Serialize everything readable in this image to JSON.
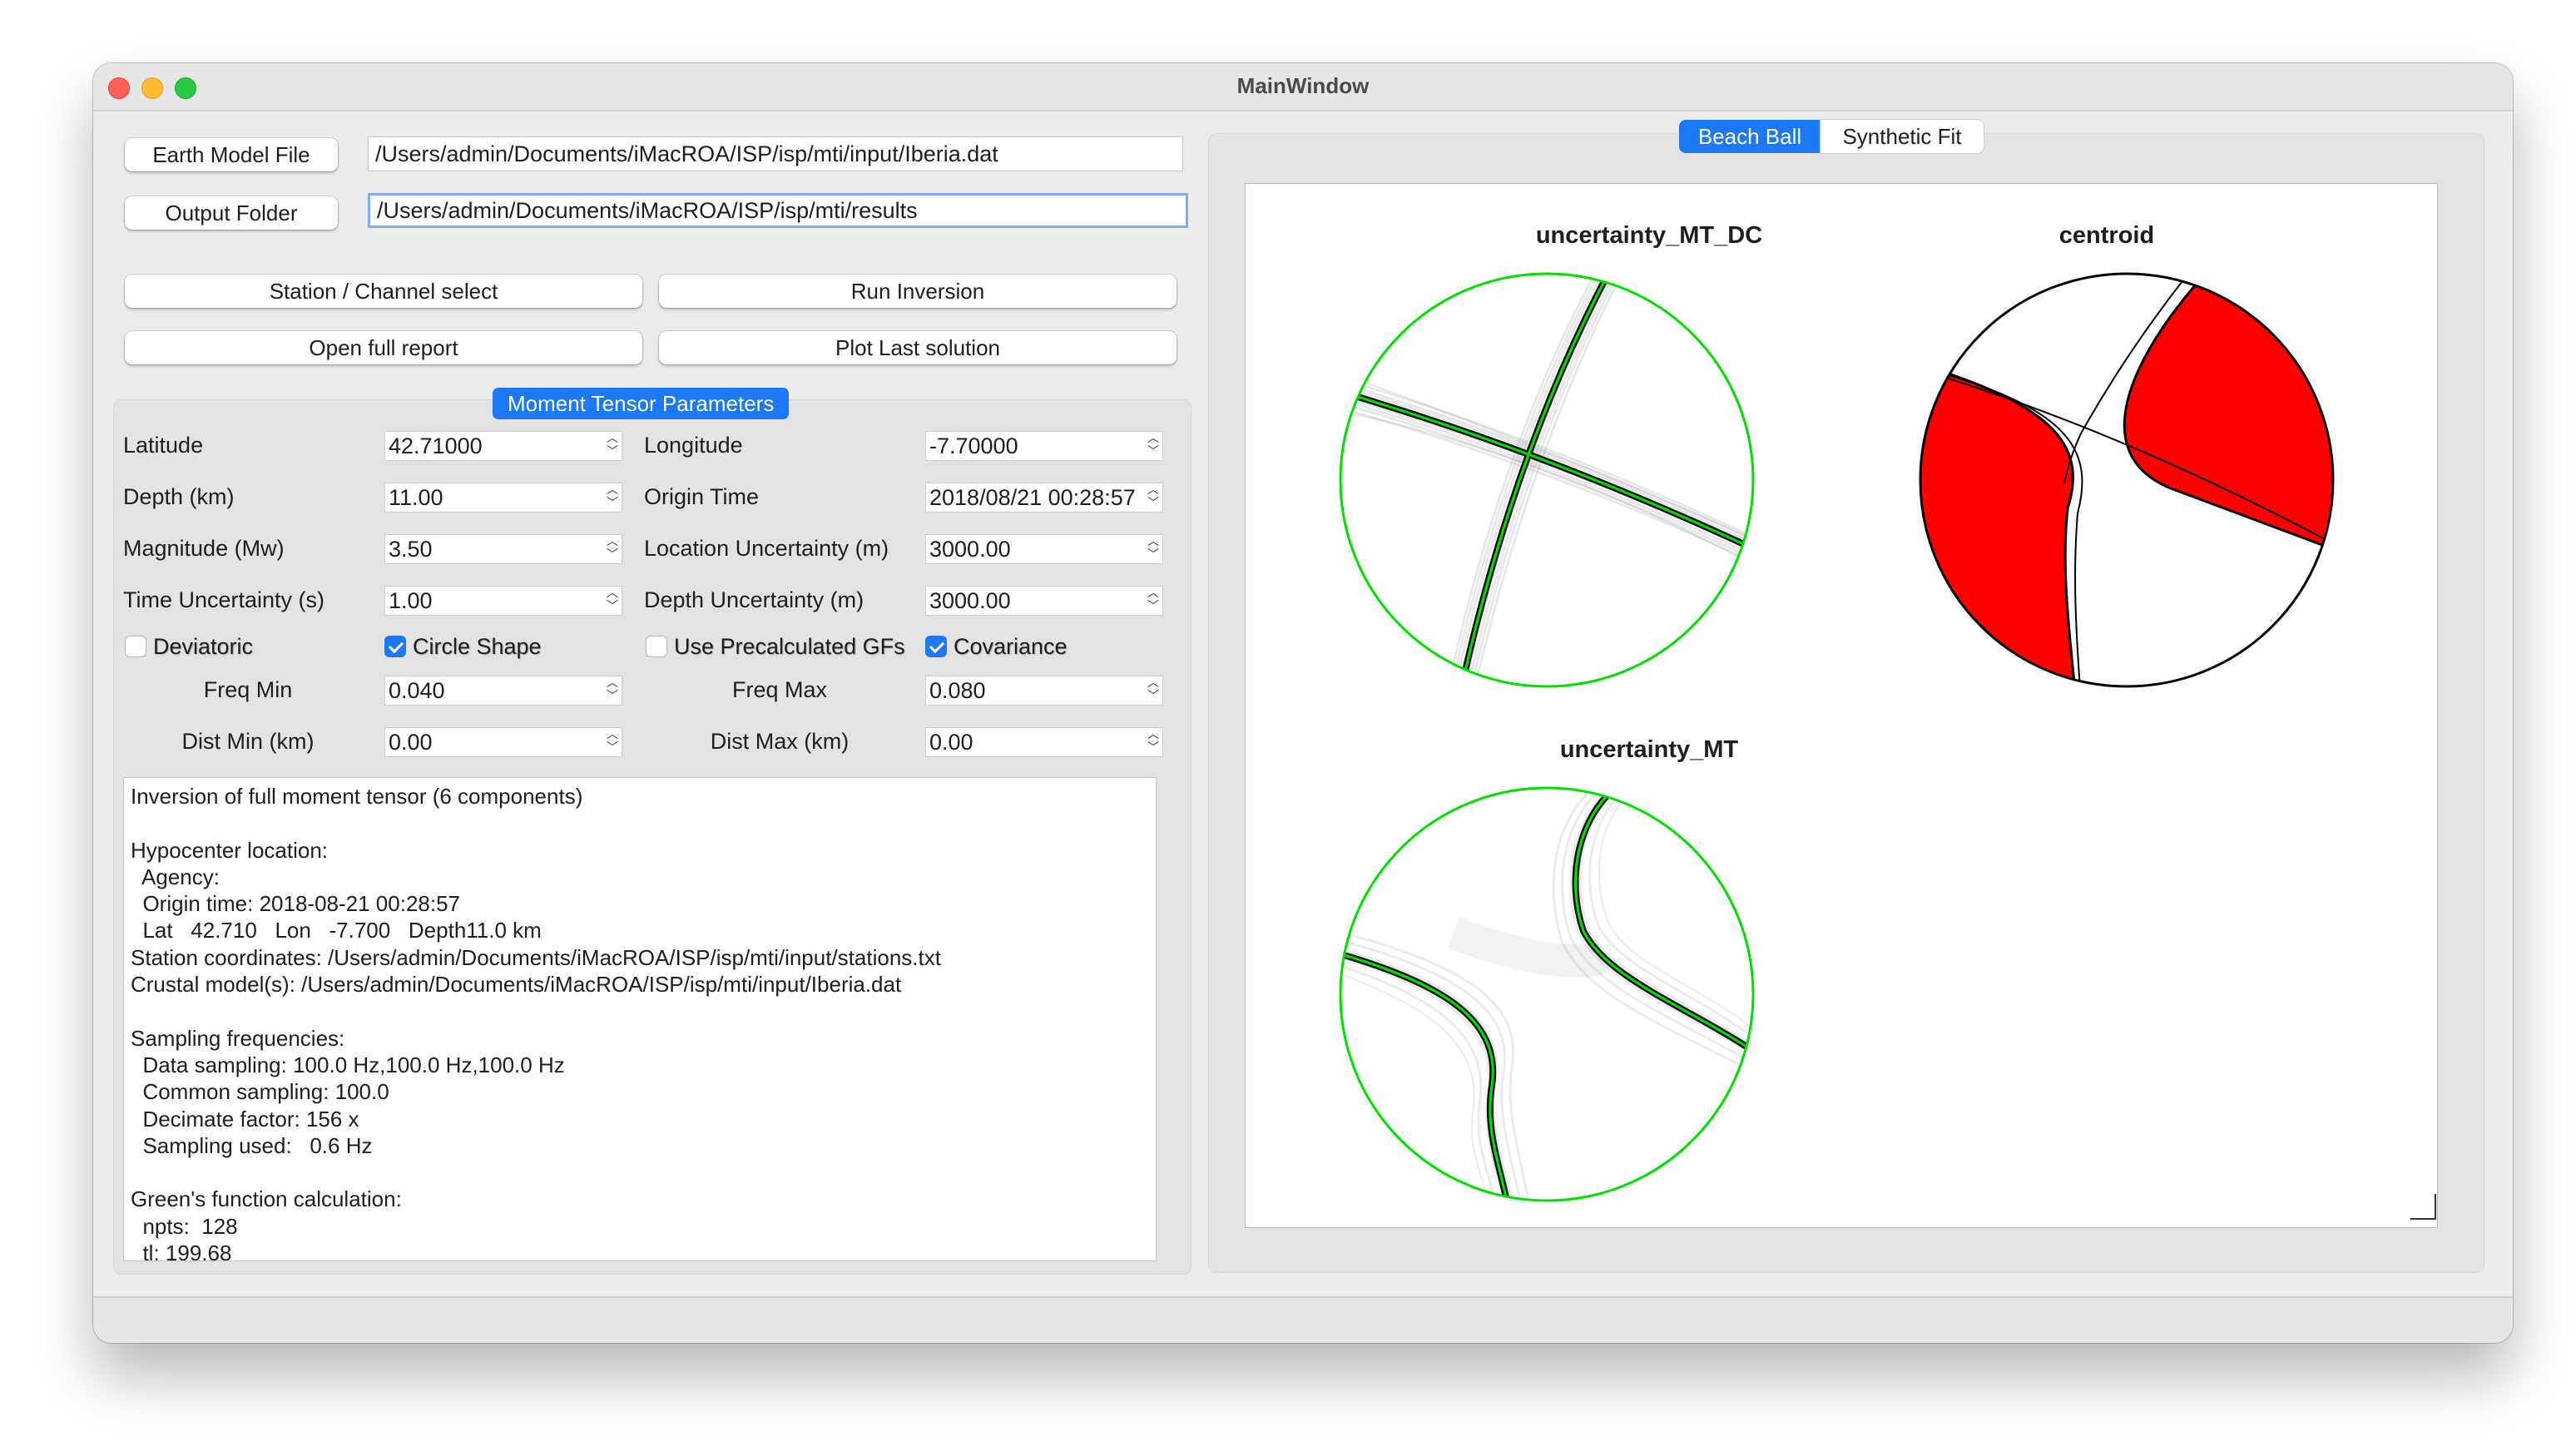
{
  "window": {
    "title": "MainWindow"
  },
  "files": {
    "earth_model_button": "Earth Model File",
    "earth_model_path": "/Users/admin/Documents/iMacROA/ISP/isp/mti/input/Iberia.dat",
    "output_folder_button": "Output Folder",
    "output_folder_path": "/Users/admin/Documents/iMacROA/ISP/isp/mti/results"
  },
  "actions": {
    "station_select": "Station / Channel select",
    "run_inversion": "Run Inversion",
    "open_report": "Open full report",
    "plot_last": "Plot Last solution"
  },
  "params": {
    "group_title": "Moment Tensor Parameters",
    "latitude_label": "Latitude",
    "latitude_value": "42.71000",
    "longitude_label": "Longitude",
    "longitude_value": "-7.70000",
    "depth_label": "Depth (km)",
    "depth_value": "11.00",
    "origin_time_label": "Origin Time",
    "origin_time_value": "2018/08/21 00:28:57",
    "magnitude_label": "Magnitude (Mw)",
    "magnitude_value": "3.50",
    "location_unc_label": "Location Uncertainty (m)",
    "location_unc_value": "3000.00",
    "time_unc_label": "Time Uncertainty (s)",
    "time_unc_value": "1.00",
    "depth_unc_label": "Depth Uncertainty (m)",
    "depth_unc_value": "3000.00",
    "deviatoric_label": "Deviatoric",
    "deviatoric_checked": false,
    "circle_shape_label": "Circle Shape",
    "circle_shape_checked": true,
    "precalc_gfs_label": "Use Precalculated GFs",
    "precalc_gfs_checked": false,
    "covariance_label": "Covariance",
    "covariance_checked": true,
    "freq_min_label": "Freq Min",
    "freq_min_value": "0.040",
    "freq_max_label": "Freq Max",
    "freq_max_value": "0.080",
    "dist_min_label": "Dist Min (km)",
    "dist_min_value": "0.00",
    "dist_max_label": "Dist Max (km)",
    "dist_max_value": "0.00"
  },
  "report": {
    "lines": [
      "Inversion of full moment tensor (6 components)",
      "",
      "Hypocenter location:",
      "  Agency:",
      "  Origin time: 2018-08-21 00:28:57",
      "  Lat   42.710   Lon   -7.700   Depth11.0 km",
      "Station coordinates: /Users/admin/Documents/iMacROA/ISP/isp/mti/input/stations.txt",
      "Crustal model(s): /Users/admin/Documents/iMacROA/ISP/isp/mti/input/Iberia.dat",
      "",
      "Sampling frequencies:",
      "  Data sampling: 100.0 Hz,100.0 Hz,100.0 Hz",
      "  Common sampling: 100.0",
      "  Decimate factor: 156 x",
      "  Sampling used:   0.6 Hz",
      "",
      "Green's function calculation:",
      "  npts:  128",
      "  tl: 199.68"
    ]
  },
  "tabs": {
    "beach_ball": "Beach Ball",
    "synthetic_fit": "Synthetic Fit"
  },
  "plots": {
    "uncertainty_mt_dc": "uncertainty_MT_DC",
    "centroid": "centroid",
    "uncertainty_mt": "uncertainty_MT"
  },
  "colors": {
    "accent": "#1c78f5",
    "compression": "#ff0000",
    "nodal_green": "#00e000"
  }
}
